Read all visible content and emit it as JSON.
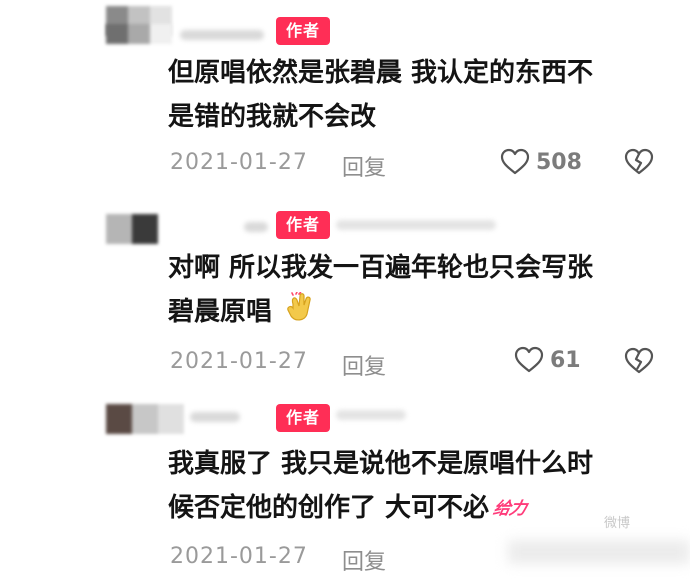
{
  "author_label": "作者",
  "reply_label": "回复",
  "colors": {
    "author_badge": "#ff2e56",
    "text": "#141414",
    "meta": "#9a9a9a",
    "sticker": "#ff3b7a"
  },
  "icons": {
    "like": "heart-outline-icon",
    "dislike": "broken-heart-icon",
    "emoji": "clapping-hands-emoji",
    "sticker": "geili-sticker"
  },
  "comments": [
    {
      "lines": [
        "但原唱依然是张碧晨 我认定的东西不",
        "是错的我就不会改"
      ],
      "date": "2021-01-27",
      "likes": "508"
    },
    {
      "lines": [
        "对啊 所以我发一百遍年轮也只会写张",
        "碧晨原唱"
      ],
      "date": "2021-01-27",
      "likes": "61"
    },
    {
      "lines": [
        "我真服了 我只是说他不是原唱什么时",
        "候否定他的创作了 大可不必"
      ],
      "date": "2021-01-27",
      "sticker_text": "给力",
      "watermark": "微博"
    }
  ]
}
